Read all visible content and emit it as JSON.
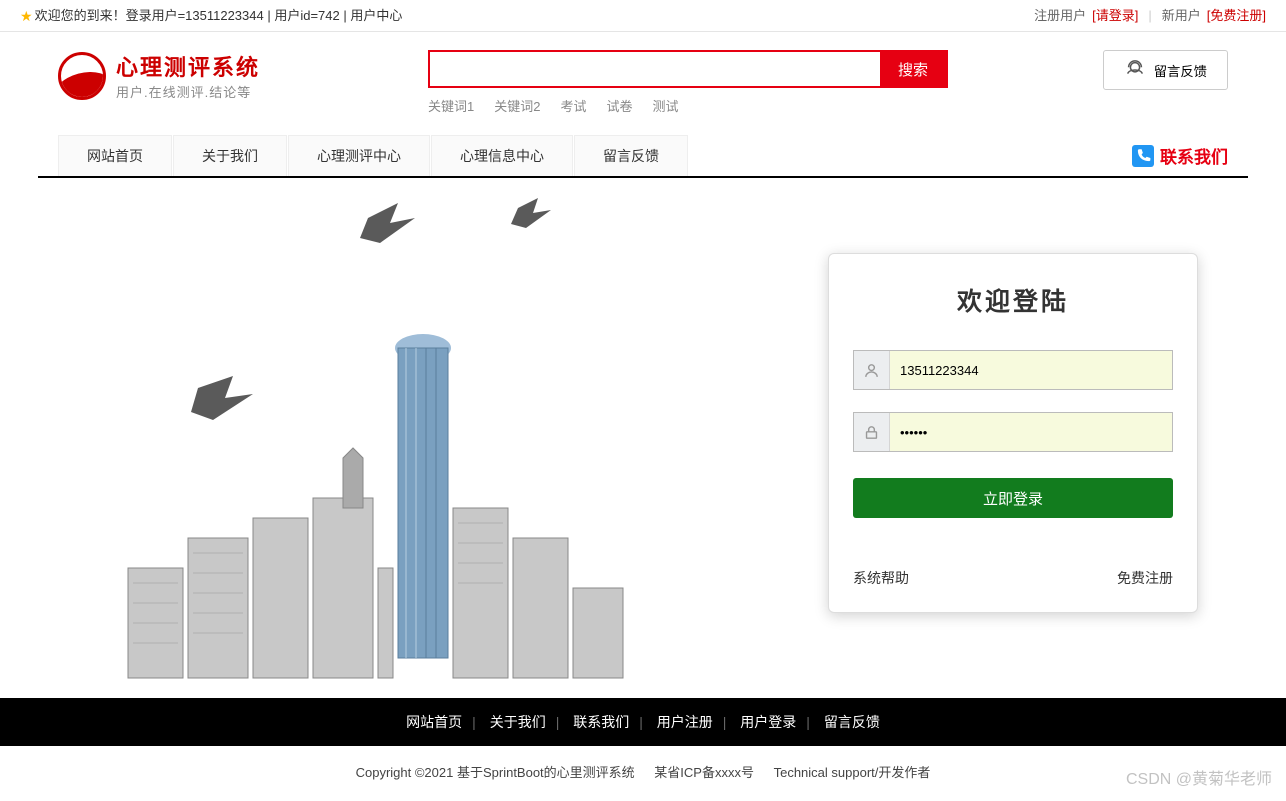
{
  "topbar": {
    "welcome": "欢迎您的到来！登录用户=13511223344 | 用户id=742 | 用户中心",
    "registered_label": "注册用户",
    "login_link": "[请登录]",
    "new_user_label": "新用户",
    "register_link": "[免费注册]"
  },
  "header": {
    "logo_title": "心理测评系统",
    "logo_sub": "用户.在线测评.结论等",
    "search_placeholder": "",
    "search_btn": "搜索",
    "keywords": [
      "关键词1",
      "关键词2",
      "考试",
      "试卷",
      "测试"
    ],
    "feedback_btn": "留言反馈"
  },
  "nav": {
    "items": [
      "网站首页",
      "关于我们",
      "心理测评中心",
      "心理信息中心",
      "留言反馈"
    ],
    "contact": "联系我们"
  },
  "login": {
    "title": "欢迎登陆",
    "username_value": "13511223344",
    "password_value": "••••••",
    "submit": "立即登录",
    "help": "系统帮助",
    "free_register": "免费注册"
  },
  "footer": {
    "links": [
      "网站首页",
      "关于我们",
      "联系我们",
      "用户注册",
      "用户登录",
      "留言反馈"
    ],
    "copyright": "Copyright ©2021 基于SprintBoot的心里测评系统",
    "icp": "某省ICP备xxxx号",
    "tech": "Technical support/开发作者"
  },
  "watermark": "CSDN @黄菊华老师"
}
